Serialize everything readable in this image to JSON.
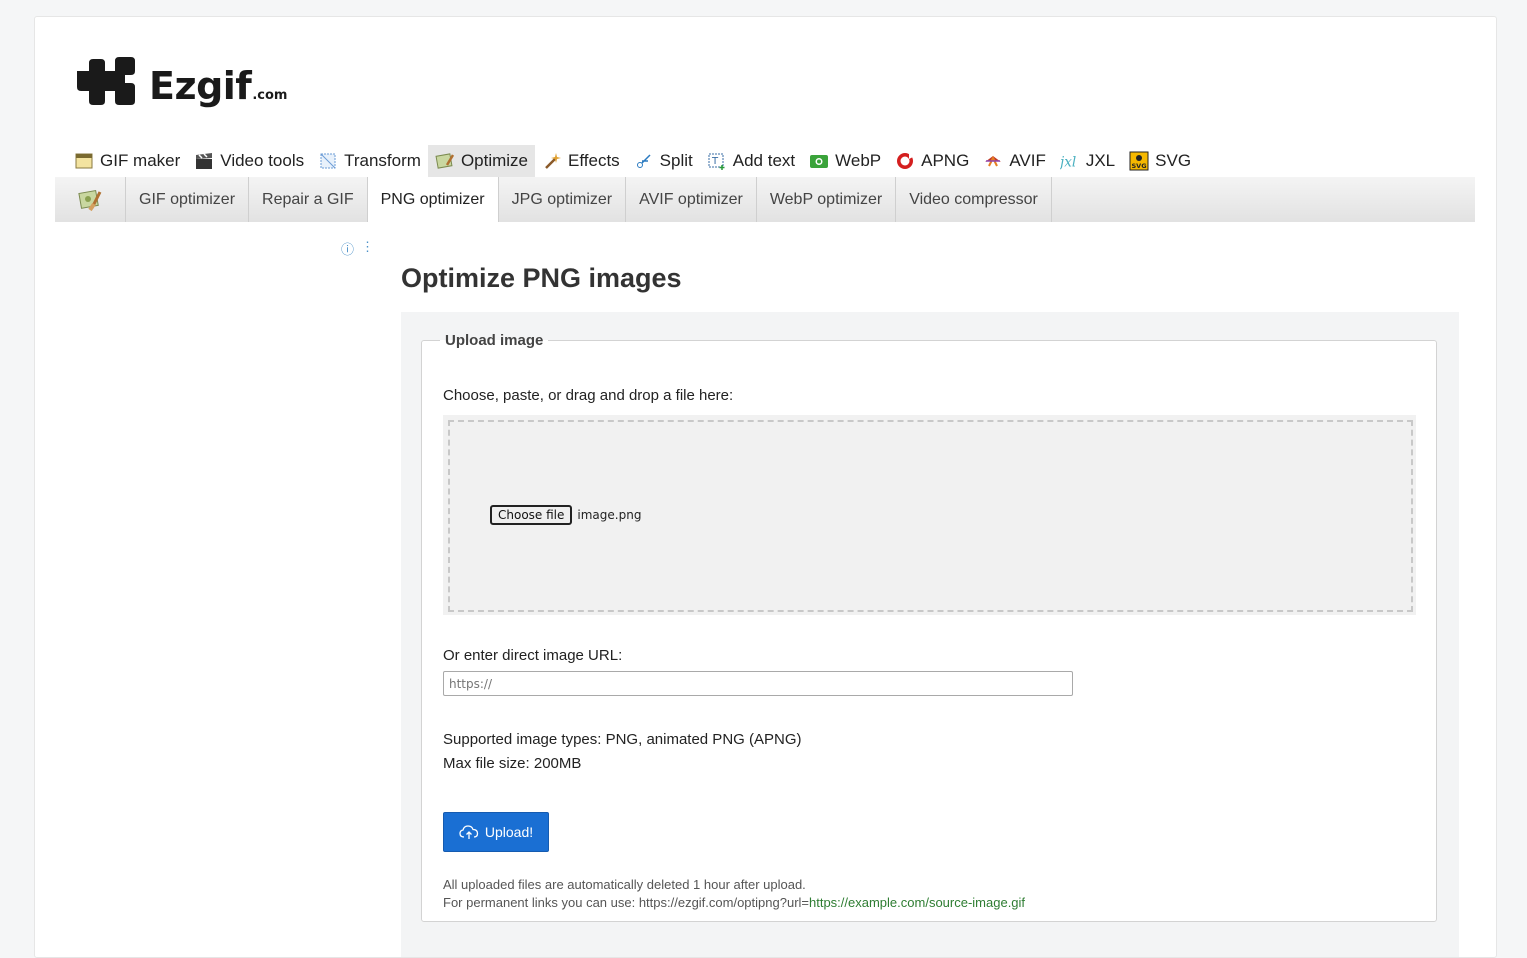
{
  "logo": {
    "name": "Ezgif",
    "suffix": ".com"
  },
  "mainnav": [
    {
      "label": "GIF maker",
      "icon": "gif-maker-icon"
    },
    {
      "label": "Video tools",
      "icon": "clapperboard-icon"
    },
    {
      "label": "Transform",
      "icon": "transform-icon"
    },
    {
      "label": "Optimize",
      "icon": "optimize-icon",
      "active": true
    },
    {
      "label": "Effects",
      "icon": "magic-wand-icon"
    },
    {
      "label": "Split",
      "icon": "split-icon"
    },
    {
      "label": "Add text",
      "icon": "add-text-icon"
    },
    {
      "label": "WebP",
      "icon": "webp-icon"
    },
    {
      "label": "APNG",
      "icon": "apng-icon"
    },
    {
      "label": "AVIF",
      "icon": "avif-icon"
    },
    {
      "label": "JXL",
      "icon": "jxl-icon"
    },
    {
      "label": "SVG",
      "icon": "svg-icon"
    }
  ],
  "subnav": [
    {
      "label": "GIF optimizer"
    },
    {
      "label": "Repair a GIF"
    },
    {
      "label": "PNG optimizer",
      "active": true
    },
    {
      "label": "JPG optimizer"
    },
    {
      "label": "AVIF optimizer"
    },
    {
      "label": "WebP optimizer"
    },
    {
      "label": "Video compressor"
    }
  ],
  "page": {
    "title": "Optimize PNG images"
  },
  "form": {
    "legend": "Upload image",
    "choose_label": "Choose, paste, or drag and drop a file here:",
    "file_button": "Choose file",
    "file_name": "image.png",
    "url_label": "Or enter direct image URL:",
    "url_placeholder": "https://",
    "supported": "Supported image types: PNG, animated PNG (APNG)",
    "max_size": "Max file size: 200MB",
    "upload_button": "Upload!",
    "note_deleted": "All uploaded files are automatically deleted 1 hour after upload.",
    "note_permanent_prefix": "For permanent links you can use: https://ezgif.com/optipng?url=",
    "note_permanent_link": "https://example.com/source-image.gif"
  },
  "colors": {
    "accent": "#1a6fd3",
    "link_green": "#2e7d32"
  }
}
